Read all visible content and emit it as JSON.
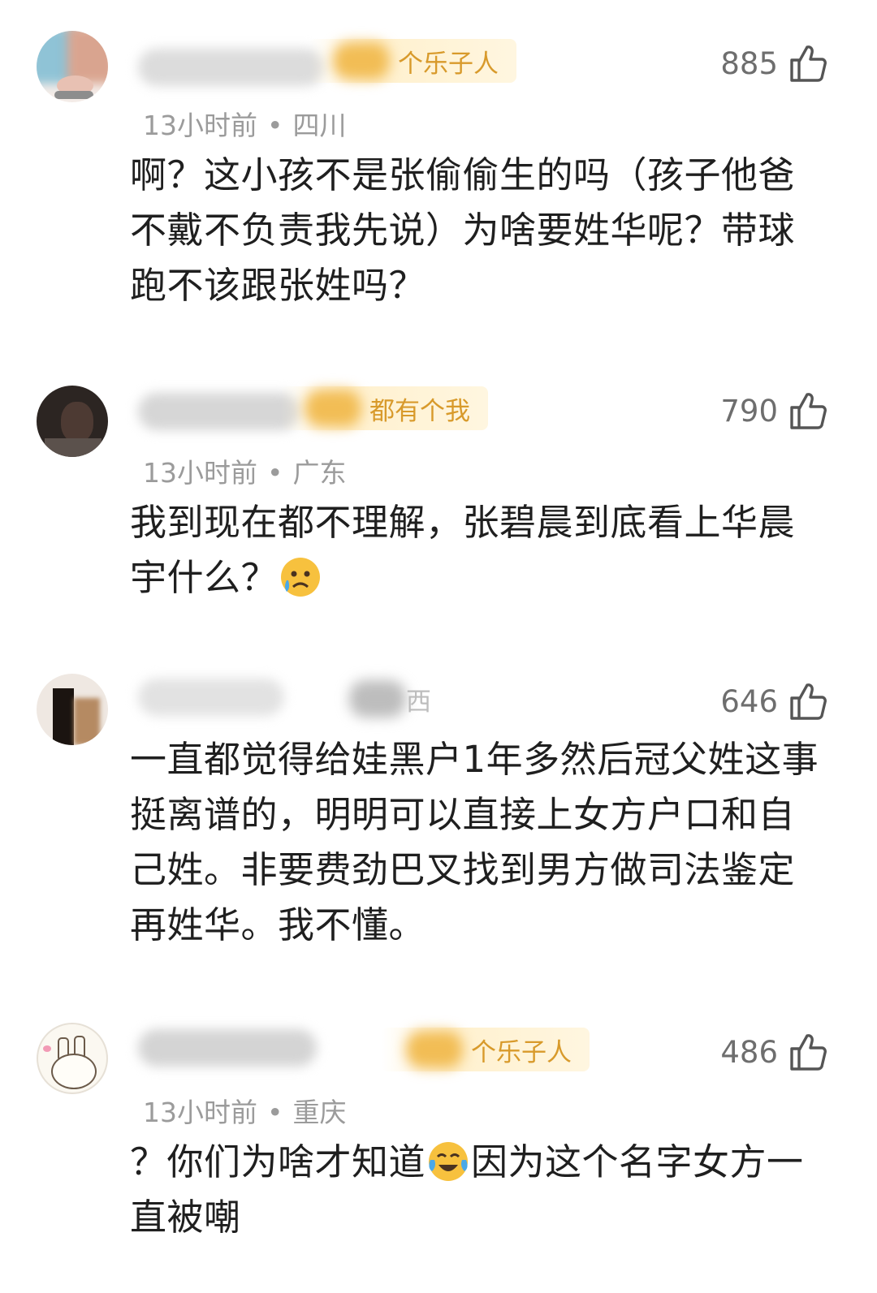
{
  "comments": [
    {
      "badge": "个乐子人",
      "likes": "885",
      "time": "13小时前",
      "location": "四川",
      "text": "啊？这小孩不是张偷偷生的吗（孩子他爸不戴不负责我先说）为啥要姓华呢？带球跑不该跟张姓吗？"
    },
    {
      "badge": "都有个我",
      "likes": "790",
      "time": "13小时前",
      "location": "广东",
      "text_before_emoji": "我到现在都不理解，张碧晨到底看上华晨宇什么？",
      "emoji": "sad-tear-face",
      "text_after_emoji": ""
    },
    {
      "badge": "西",
      "likes": "646",
      "text": "一直都觉得给娃黑户1年多然后冠父姓这事挺离谱的，明明可以直接上女方户口和自己姓。非要费劲巴叉找到男方做司法鉴定再姓华。我不懂。"
    },
    {
      "badge": "个乐子人",
      "likes": "486",
      "time": "13小时前",
      "location": "重庆",
      "text_before_emoji": "？你们为啥才知道",
      "emoji": "tears-of-joy-face",
      "text_after_emoji": "因为这个名字女方一直被嘲"
    }
  ],
  "separator": "•",
  "colors": {
    "badge_text": "#d89a2b",
    "meta_text": "#9b9b9b",
    "body_text": "#1f1f1f",
    "likes_text": "#6e6e6e"
  }
}
